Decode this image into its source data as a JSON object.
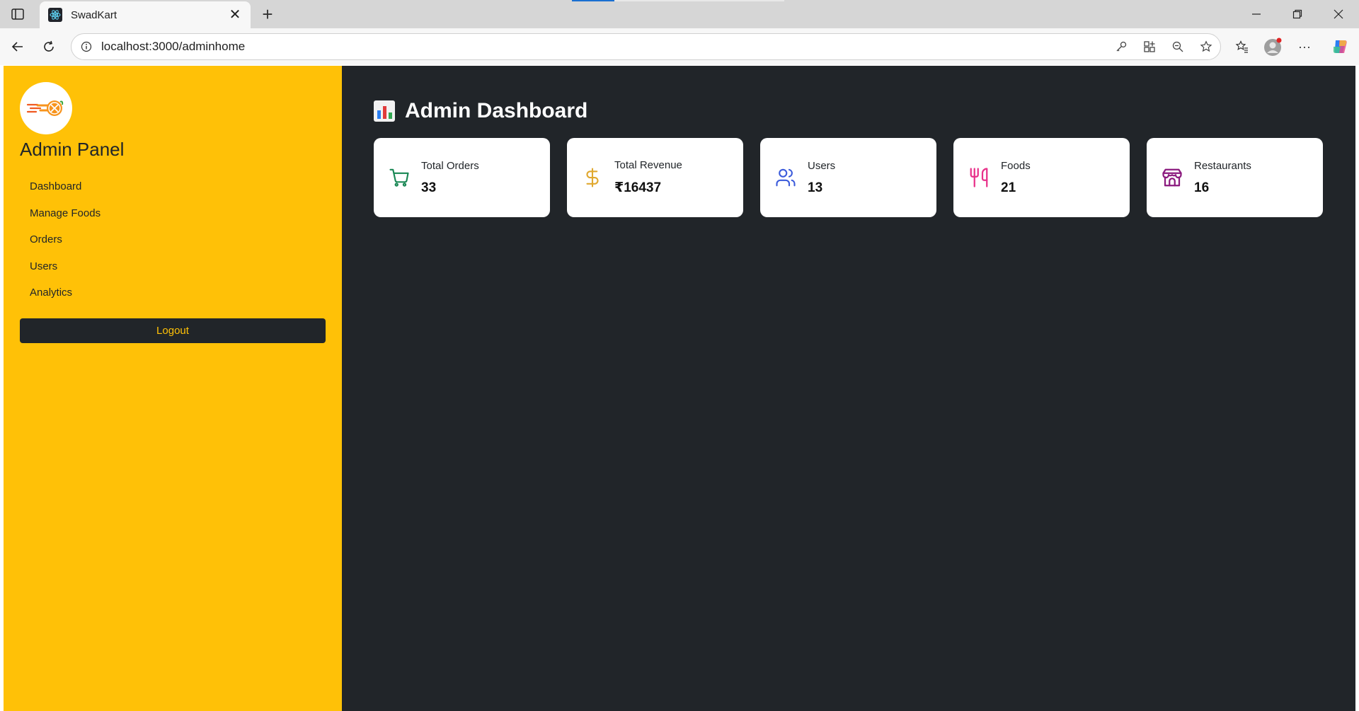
{
  "browser": {
    "tab_title": "SwadKart",
    "url": "localhost:3000/adminhome",
    "new_tab_symbol": "+",
    "close_symbol": "✕",
    "more_symbol": "···"
  },
  "sidebar": {
    "title": "Admin Panel",
    "items": [
      {
        "label": "Dashboard"
      },
      {
        "label": "Manage Foods"
      },
      {
        "label": "Orders"
      },
      {
        "label": "Users"
      },
      {
        "label": "Analytics"
      }
    ],
    "logout_label": "Logout"
  },
  "main": {
    "title": "Admin Dashboard",
    "title_icon": "bar-chart-emoji",
    "cards": [
      {
        "label": "Total Orders",
        "value": "33",
        "icon": "cart-icon",
        "color": "#198754"
      },
      {
        "label": "Total Revenue",
        "value": "₹16437",
        "icon": "dollar-icon",
        "color": "#e0a82e"
      },
      {
        "label": "Users",
        "value": "13",
        "icon": "users-icon",
        "color": "#3b5bdb"
      },
      {
        "label": "Foods",
        "value": "21",
        "icon": "utensils-icon",
        "color": "#e8318a"
      },
      {
        "label": "Restaurants",
        "value": "16",
        "icon": "store-icon",
        "color": "#8b1a7e"
      }
    ]
  },
  "colors": {
    "sidebar_bg": "#ffc107",
    "main_bg": "#212529",
    "card_bg": "#ffffff"
  }
}
